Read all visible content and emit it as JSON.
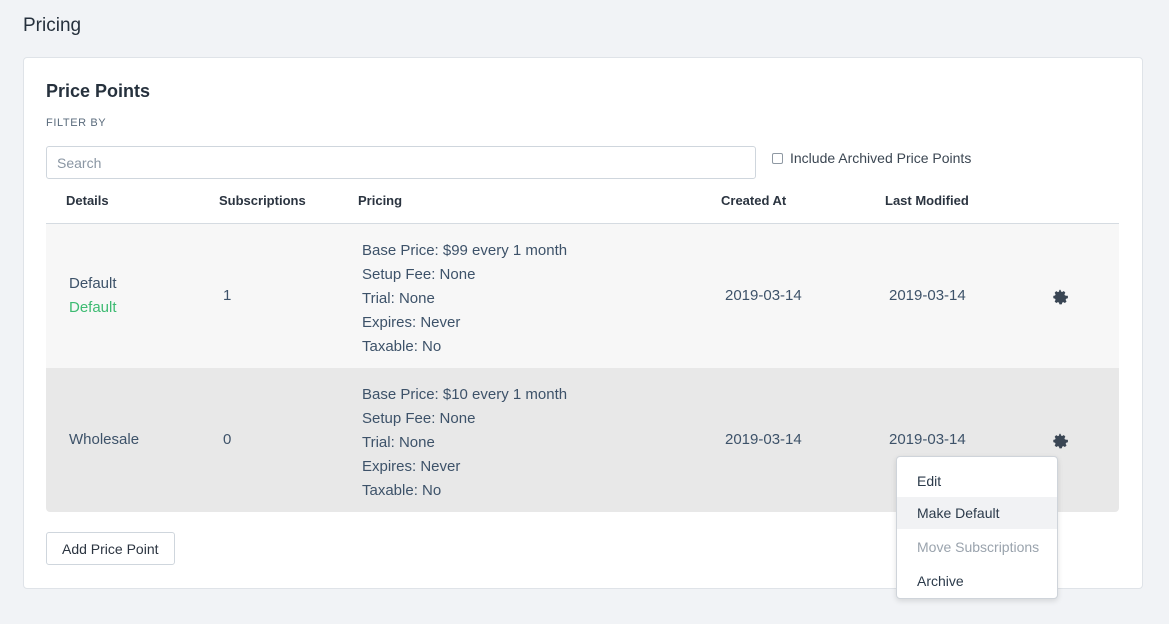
{
  "page": {
    "title": "Pricing"
  },
  "card": {
    "title": "Price Points",
    "filter_label": "FILTER BY",
    "search_placeholder": "Search",
    "include_archived_label": "Include Archived Price Points"
  },
  "table": {
    "headers": {
      "details": "Details",
      "subscriptions": "Subscriptions",
      "pricing": "Pricing",
      "created_at": "Created At",
      "last_modified": "Last Modified"
    },
    "rows": [
      {
        "name": "Default",
        "tag": "Default",
        "subscriptions": "1",
        "pricing": [
          "Base Price: $99 every 1 month",
          "Setup Fee: None",
          "Trial: None",
          "Expires: Never",
          "Taxable: No"
        ],
        "created_at": "2019-03-14",
        "last_modified": "2019-03-14"
      },
      {
        "name": "Wholesale",
        "subscriptions": "0",
        "pricing": [
          "Base Price: $10 every 1 month",
          "Setup Fee: None",
          "Trial: None",
          "Expires: Never",
          "Taxable: No"
        ],
        "created_at": "2019-03-14",
        "last_modified": "2019-03-14"
      }
    ]
  },
  "actions": {
    "add_price_point": "Add Price Point"
  },
  "context_menu": {
    "items": [
      {
        "label": "Edit",
        "state": "normal"
      },
      {
        "label": "Make Default",
        "state": "hover"
      },
      {
        "label": "Move Subscriptions",
        "state": "disabled"
      },
      {
        "label": "Archive",
        "state": "normal"
      }
    ]
  },
  "icons": {
    "row_actions": "gear-icon"
  },
  "colors": {
    "default_tag": "#3dbb72",
    "text": "#3d5269"
  }
}
